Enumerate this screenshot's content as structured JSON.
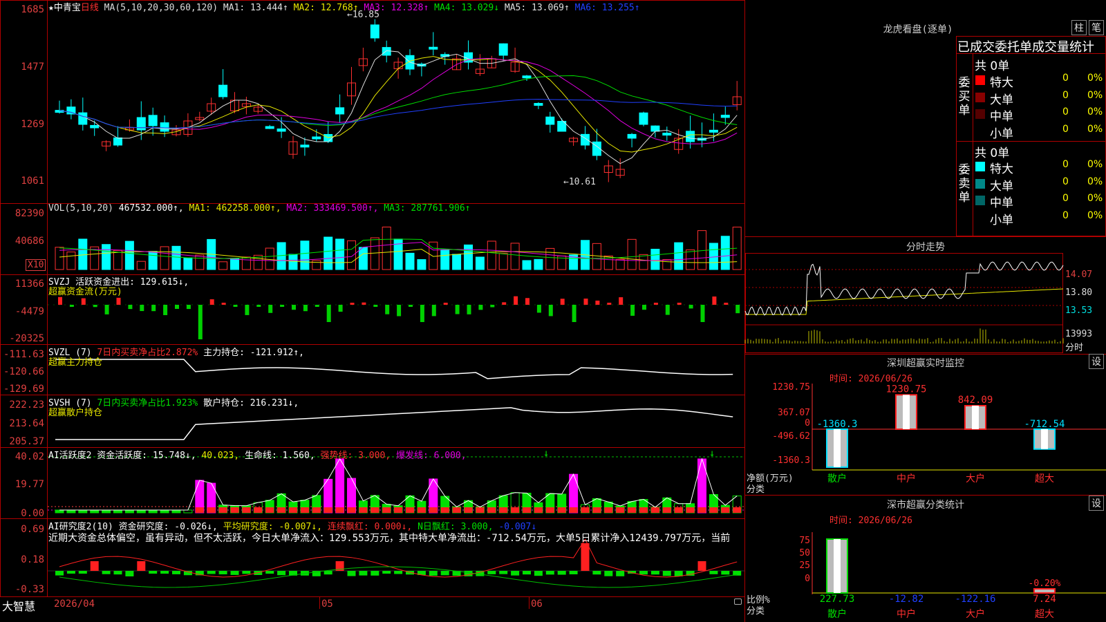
{
  "header": {
    "stock": "★中青宝",
    "period": "日线",
    "ma_label": "MA(5,10,20,30,60,120)",
    "ma": [
      {
        "t": "MA1: 13.444↑",
        "c": "#e0e0e0"
      },
      {
        "t": "MA2: 12.768↑",
        "c": "#e8e800"
      },
      {
        "t": "MA3: 12.328↑",
        "c": "#e000e0"
      },
      {
        "t": "MA4: 13.029↓",
        "c": "#00e000"
      },
      {
        "t": "MA5: 13.069↑",
        "c": "#e0e0e0"
      },
      {
        "t": "MA6: 13.255↑",
        "c": "#2040ff"
      }
    ],
    "high_mark": "←16.85",
    "low_mark": "←10.61"
  },
  "price_axis": [
    "1685",
    "1477",
    "1269",
    "1061"
  ],
  "vol": {
    "label": "VOL(5,10,20)",
    "items": [
      {
        "t": "467532.000↑,",
        "c": "#fff"
      },
      {
        "t": "MA1: 462258.000↑,",
        "c": "#e8e800"
      },
      {
        "t": "MA2: 333469.500↑,",
        "c": "#e000e0"
      },
      {
        "t": "MA3: 287761.906↑",
        "c": "#00e000"
      }
    ],
    "axis": [
      "82390",
      "40686"
    ],
    "unit": "X10"
  },
  "svzj": {
    "label": "SVZJ  活跃资金进出: 129.615↓,",
    "sub": "超赢资金流(万元)",
    "axis": [
      "11366",
      "-4479",
      "-20325"
    ]
  },
  "svzl": {
    "label": "SVZL (7)",
    "mid": "7日内买卖净占比2.872%",
    "tail": "主力持仓: -121.912↑,",
    "sub": "超赢主力持仓",
    "axis": [
      "-111.63",
      "-120.66",
      "-129.69"
    ]
  },
  "svsh": {
    "label": "SVSH (7)",
    "mid": "7日内买卖净占比1.923%",
    "tail": "散户持仓: 216.231↓,",
    "sub": "超赢散户持仓",
    "axis": [
      "222.23",
      "213.64",
      "205.37"
    ]
  },
  "ai1": {
    "items": [
      {
        "t": "AI活跃度2 资金活跃度: 15.748↓,",
        "c": "#fff"
      },
      {
        "t": "40.023,",
        "c": "#e8e800"
      },
      {
        "t": "生命线: 1.560,",
        "c": "#fff"
      },
      {
        "t": "强势线: 3.000,",
        "c": "#ff3030"
      },
      {
        "t": "爆发线: 6.000,",
        "c": "#e000e0"
      }
    ],
    "axis": [
      "40.02",
      "19.77",
      "0.00"
    ]
  },
  "ai2": {
    "items": [
      {
        "t": "AI研究度2(10) 资金研究度: -0.026↓,",
        "c": "#fff"
      },
      {
        "t": "平均研究度: -0.007↓,",
        "c": "#e8e800"
      },
      {
        "t": "连续飘红: 0.000↓,",
        "c": "#ff3030"
      },
      {
        "t": "N日飘红: 3.000,",
        "c": "#00e000"
      },
      {
        "t": "-0.007↓",
        "c": "#2040ff"
      }
    ],
    "text": "近期大资金总体偏空，虽有异动，但不太活跃，今日大单净流入：129.553万元，其中特大单净流出：-712.54万元，大单5日累计净入12439.797万元，当前",
    "axis": [
      "0.69",
      "0.18",
      "-0.33"
    ]
  },
  "bottom": {
    "brand": "大智慧",
    "date": "2026/04",
    "m1": "05",
    "m2": "06"
  },
  "right": {
    "lhb_title": "龙虎看盘(逐单)",
    "btn1": "柱",
    "btn2": "笔",
    "table_head": "已成交委托单成交量统计",
    "buy_side": "委买单",
    "sell_side": "委卖单",
    "buy_total": "共 0单",
    "sell_total": "共 0单",
    "buy_rows": [
      {
        "n": "特大",
        "v": "0",
        "p": "0%",
        "c": "#ff0000"
      },
      {
        "n": "大单",
        "v": "0",
        "p": "0%",
        "c": "#880000"
      },
      {
        "n": "中单",
        "v": "0",
        "p": "0%",
        "c": "#550000"
      },
      {
        "n": "小单",
        "v": "0",
        "p": "0%",
        "c": "#000000"
      }
    ],
    "sell_rows": [
      {
        "n": "特大",
        "v": "0",
        "p": "0%",
        "c": "#00ffff"
      },
      {
        "n": "大单",
        "v": "0",
        "p": "0%",
        "c": "#008888"
      },
      {
        "n": "中单",
        "v": "0",
        "p": "0%",
        "c": "#006666"
      },
      {
        "n": "小单",
        "v": "0",
        "p": "0%",
        "c": "#000000"
      }
    ],
    "fs_title": "分时走势",
    "fs_axis": [
      "14.07",
      "13.80",
      "13.53"
    ],
    "fs_vol": "13993",
    "fs_unit": "分时",
    "sz_title": "深圳超赢实时监控",
    "sz_set": "设",
    "sz_time": "时间: 2026/06/26",
    "sz_axis": [
      "1230.75",
      "367.07",
      "0",
      "-496.62",
      "-1360.3"
    ],
    "sz_values": [
      {
        "cat": "散户",
        "v": -1360.3,
        "label": "-1360.3"
      },
      {
        "cat": "中户",
        "v": 1230.75,
        "label": "1230.75"
      },
      {
        "cat": "大户",
        "v": 842.09,
        "label": "842.09"
      },
      {
        "cat": "超大",
        "v": -712.54,
        "label": "-712.54"
      }
    ],
    "sz_ylabel": "净额(万元)",
    "sz_xlabel": "分类",
    "cls_title": "深市超赢分类统计",
    "cls_set": "设",
    "cls_time": "时间: 2026/06/26",
    "cls_axis": [
      "75",
      "50",
      "25",
      "0"
    ],
    "cls_values": [
      {
        "cat": "散户",
        "label": "227.73"
      },
      {
        "cat": "中户",
        "label": "-12.82"
      },
      {
        "cat": "大户",
        "label": "-122.16"
      },
      {
        "cat": "超大",
        "label": "7.24",
        "extra": "-0.20%"
      }
    ],
    "cls_ylabel": "比例%",
    "cls_xlabel": "分类"
  },
  "colors": {
    "up": "#ff3030",
    "down": "#00ffff",
    "grid": "#b00000"
  }
}
